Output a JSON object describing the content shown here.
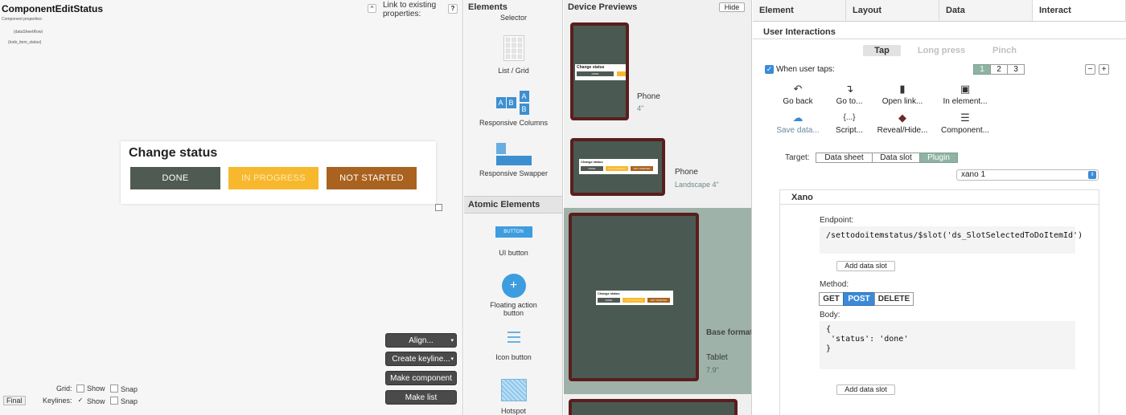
{
  "canvas": {
    "component_name": "ComponentEditStatus",
    "component_properties_label": "Component properties:",
    "prop_1": "(dataSheetRow)",
    "prop_2": "(todo_item_status)",
    "link_label": "Link to existing properties:",
    "help": "?",
    "chevron": "^",
    "card_title": "Change status",
    "status_buttons": [
      {
        "label": "DONE",
        "bg": "#4f5a53",
        "fg": "#ffffff"
      },
      {
        "label": "IN PROGRESS",
        "bg": "#f7b82e",
        "fg": "#fde9b8"
      },
      {
        "label": "NOT STARTED",
        "bg": "#a9621f",
        "fg": "#ffffff"
      }
    ],
    "toolbar": {
      "align": "Align...",
      "create_keyline": "Create keyline...",
      "make_component": "Make component",
      "make_list": "Make list"
    },
    "grid_label": "Grid:",
    "keylines_label": "Keylines:",
    "show": "Show",
    "snap": "Snap",
    "check_mark": "✓",
    "final": "Final"
  },
  "elements": {
    "title": "Elements",
    "selector": "Selector",
    "list_grid": "List / Grid",
    "responsive_columns": "Responsive Columns",
    "responsive_swapper": "Responsive Swapper",
    "atomic_title": "Atomic Elements",
    "ui_button": "UI button",
    "ui_button_icon_text": "BUTTON",
    "floating_action_button": "Floating action button",
    "icon_button": "Icon button",
    "hotspot": "Hotspot",
    "col_a": "A",
    "col_b": "B"
  },
  "previews": {
    "title": "Device Previews",
    "hide": "Hide",
    "phone": "Phone",
    "phone_size": "4\"",
    "phone_landscape": "Phone",
    "landscape_size": "Landscape 4\"",
    "base_format": "Base format",
    "tablet": "Tablet",
    "tablet_size": "7.9\""
  },
  "interact": {
    "tabs": [
      "Element",
      "Layout",
      "Data",
      "Interact"
    ],
    "section_title": "User Interactions",
    "gestures": [
      "Tap",
      "Long press",
      "Pinch"
    ],
    "when_user_taps": "When user taps:",
    "check_mark": "✓",
    "pages": [
      "1",
      "2",
      "3"
    ],
    "minus": "−",
    "plus": "+",
    "actions": [
      {
        "label": "Go back",
        "icon": "go-back-icon",
        "glyph": "↶"
      },
      {
        "label": "Go to...",
        "icon": "go-to-icon",
        "glyph": "↴"
      },
      {
        "label": "Open link...",
        "icon": "open-link-icon",
        "glyph": "▮"
      },
      {
        "label": "In element...",
        "icon": "in-element-icon",
        "glyph": "▣"
      },
      {
        "label": "Save data...",
        "icon": "save-data-icon",
        "glyph": "☁"
      },
      {
        "label": "Script...",
        "icon": "script-icon",
        "glyph": "{...}"
      },
      {
        "label": "Reveal/Hide...",
        "icon": "reveal-hide-icon",
        "glyph": "◆"
      },
      {
        "label": "Component...",
        "icon": "component-icon",
        "glyph": "☰"
      }
    ],
    "target_label": "Target:",
    "targets": [
      "Data sheet",
      "Data slot",
      "Plugin"
    ],
    "plugin_select": "xano 1",
    "select_caret": "⇕",
    "xano_title": "Xano",
    "endpoint_label": "Endpoint:",
    "endpoint_value": "/settodoitemstatus/$slot('ds_SlotSelectedToDoItemId')",
    "add_data_slot": "Add data slot",
    "method_label": "Method:",
    "methods": [
      "GET",
      "POST",
      "DELETE"
    ],
    "body_label": "Body:",
    "body_lines": [
      "{",
      " 'status': 'done'",
      "}"
    ],
    "add_data_slot_2": "Add data slot"
  },
  "colors": {
    "accent": "#3b8ad9",
    "segment_on": "#8fb3a3",
    "device_frame": "#5a1e1e",
    "device_screen": "#4a5a52"
  }
}
